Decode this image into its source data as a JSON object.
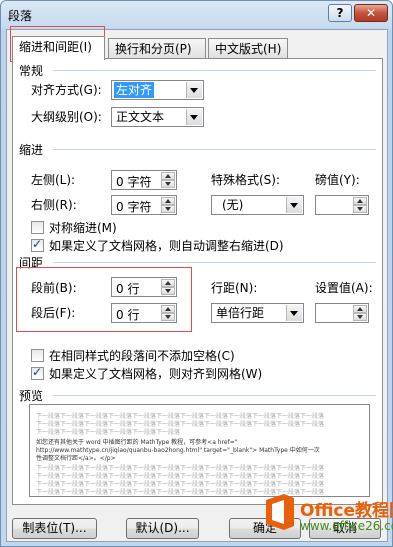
{
  "window": {
    "title": "段落",
    "help_label": "?",
    "close_label": "✕"
  },
  "tabs": [
    {
      "label": "缩进和间距(I)"
    },
    {
      "label": "换行和分页(P)"
    },
    {
      "label": "中文版式(H)"
    }
  ],
  "general": {
    "title": "常规",
    "alignment_label": "对齐方式(G):",
    "alignment_value": "左对齐",
    "outline_label": "大纲级别(O):",
    "outline_value": "正文文本"
  },
  "indent": {
    "title": "缩进",
    "left_label": "左侧(L):",
    "left_value": "0 字符",
    "right_label": "右侧(R):",
    "right_value": "0 字符",
    "special_label": "特殊格式(S):",
    "special_value": "(无)",
    "measure_label": "磅值(Y):",
    "measure_value": "",
    "mirror_label": "对称缩进(M)",
    "mirror_checked": false,
    "auto_adjust_label": "如果定义了文档网格，则自动调整右缩进(D)",
    "auto_adjust_checked": true
  },
  "spacing": {
    "title": "间距",
    "before_label": "段前(B):",
    "before_value": "0 行",
    "after_label": "段后(F):",
    "after_value": "0 行",
    "line_spacing_label": "行距(N):",
    "line_spacing_value": "单倍行距",
    "at_label": "设置值(A):",
    "at_value": "",
    "no_space_label": "在相同样式的段落间不添加空格(C)",
    "no_space_checked": false,
    "snap_grid_label": "如果定义了文档网格，则对齐到网格(W)",
    "snap_grid_checked": true
  },
  "preview": {
    "title": "预览",
    "prev_lines": [
      "下一段落下一段落下一段落下一段落下一段落下一段落下一段落下一段落下一段落下一段落下一段落下一段落",
      "下一段落下一段落下一段落下一段落下一段落下一段落下一段落下一段落下一段落下一段落下一段落下一段落",
      "下一段落下一段落下一段落下一段落下一段落下一段落"
    ],
    "text_lines": [
      "如您还有其他关于 word 中插图行距的 MathType 教程，可参考<a href=\"",
      "http://www.mathtype.cn/jiqiao/quanbu-bao2hong.html\" target=\"_blank\"> MathType 中如何一次",
      "性调整文档行距</a>。</p>"
    ],
    "next_lines": [
      "下一段落下一段落下一段落下一段落下一段落下一段落下一段落下一段落下一段落下一段落下一段落下一段落",
      "下一段落下一段落下一段落下一段落下一段落下一段落下一段落下一段落下一段落下一段落下一段落下一段落",
      "下一段落下一段落下一段落下一段落下一段落下一段落下一段落下一段落下一段落下一段落下一段落下一段落",
      "下一段落下一段落下一段落下一段落下一段落下一段落下一段落下一段落下一段落下一段落下一段落下一段落",
      "下一段落下一段落下一段落下一段落下一段落下一段落下一段落下一段落下一段落下一段落下一段落下一段落"
    ]
  },
  "buttons": {
    "tabs_label": "制表位(T)...",
    "default_label": "默认(D)...",
    "ok_label": "确定",
    "cancel_label": "取消"
  },
  "watermark": {
    "brand": "Office教程网",
    "url": "www.office26.com"
  },
  "colors": {
    "highlight_box": "#e84a4a",
    "selection": "#3399ff",
    "brand_orange": "#e8600a"
  }
}
